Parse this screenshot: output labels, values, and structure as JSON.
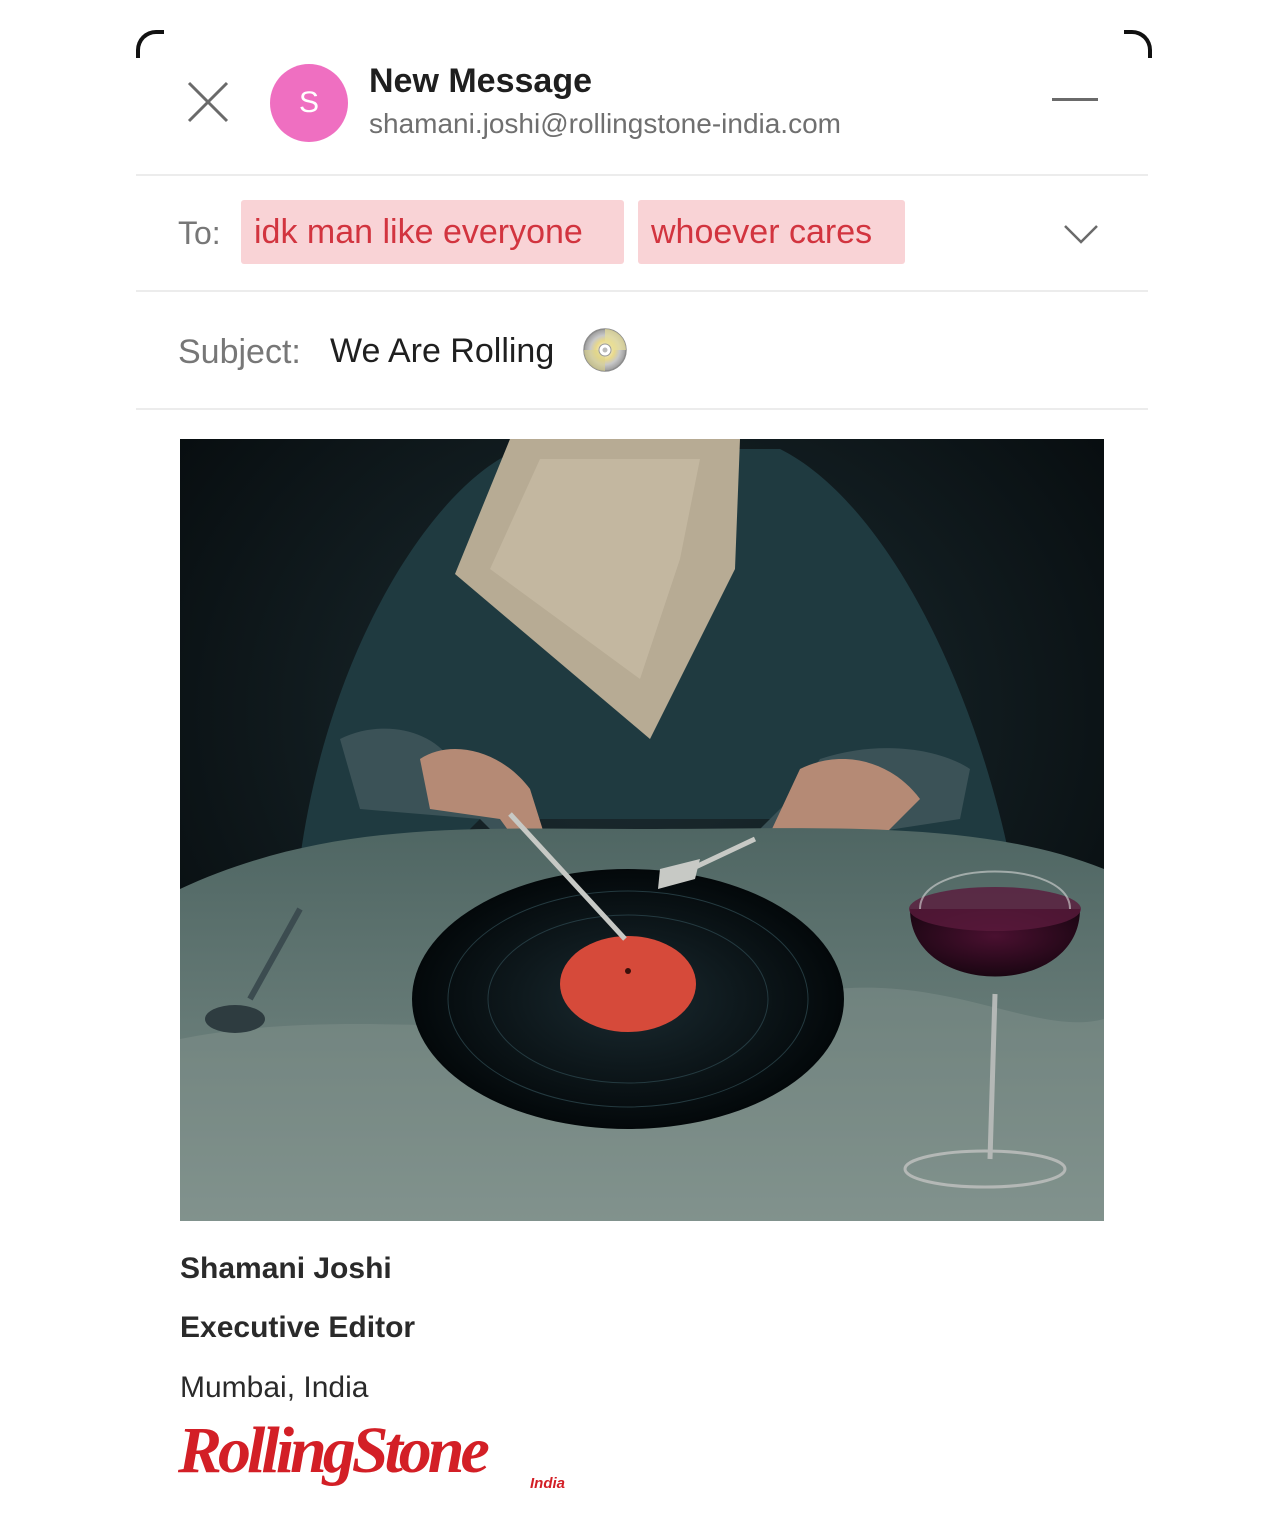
{
  "compose": {
    "title": "New Message",
    "sender_email": "shamani.joshi@rollingstone-india.com",
    "avatar_initial": "S",
    "avatar_color": "#ef6fc1",
    "close_icon": "close-icon",
    "minimize_icon": "minimize-icon"
  },
  "to": {
    "label": "To:",
    "recipients": [
      "idk man like everyone",
      "whoever cares"
    ],
    "chip_bg": "#f9d3d6",
    "chip_text_color": "#d2343f",
    "expand_icon": "chevron-down-icon"
  },
  "subject": {
    "label": "Subject:",
    "value": "We Are Rolling",
    "emoji_icon": "cd-icon"
  },
  "body": {
    "image": "photo of suited figure with napkin cutting a vinyl record with knife and fork, glass of red wine"
  },
  "signature": {
    "name": "Shamani Joshi",
    "role": "Executive Editor",
    "location": "Mumbai, India",
    "logo_text": "RollingStone",
    "logo_sub": "India",
    "logo_color": "#d31f26"
  }
}
